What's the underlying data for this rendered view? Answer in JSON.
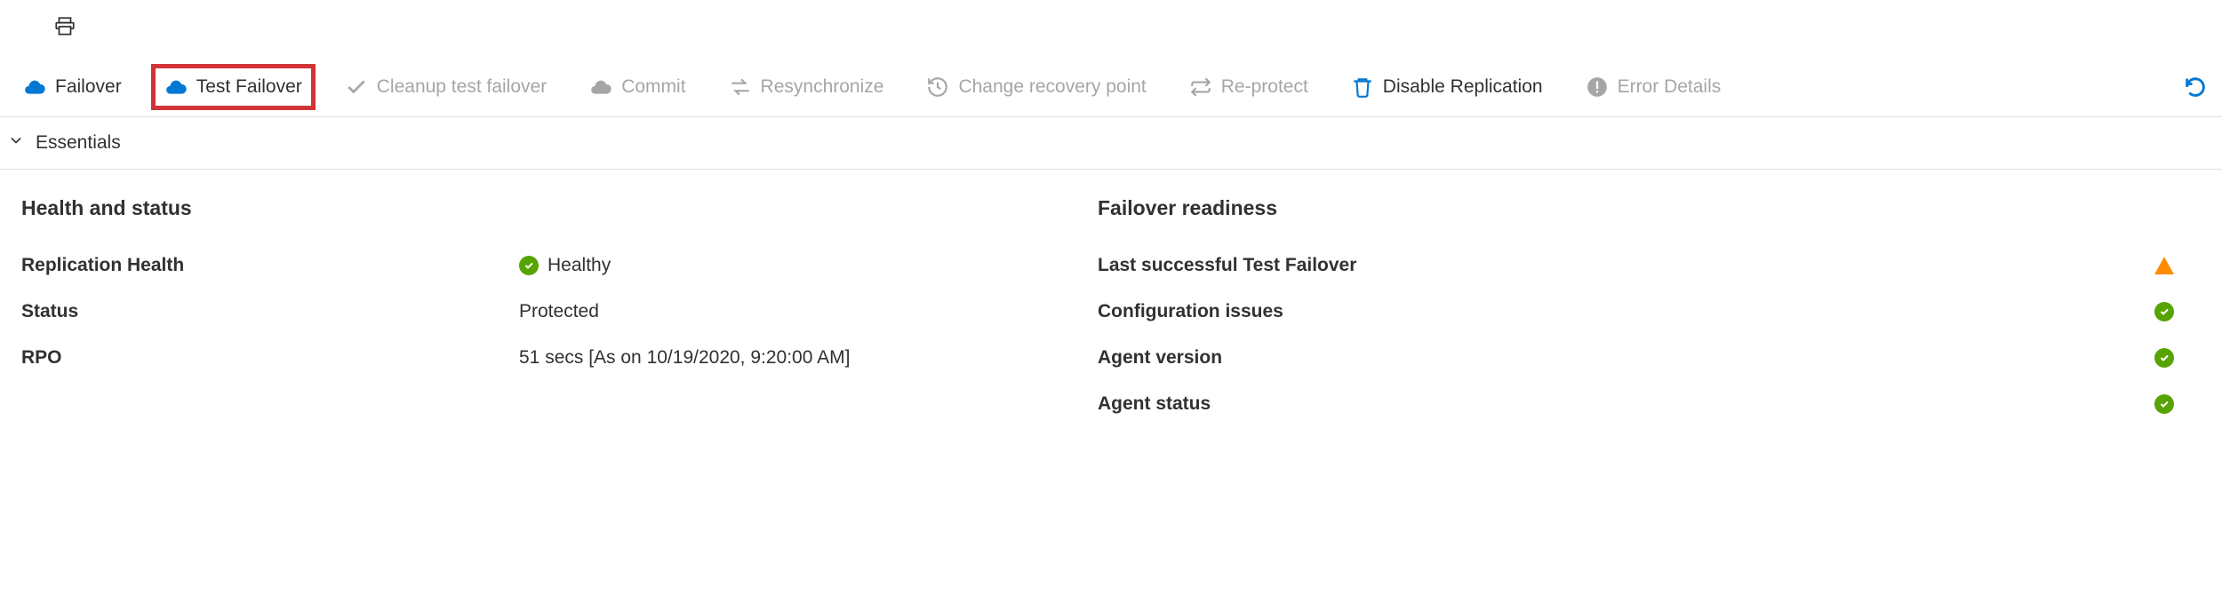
{
  "toolbar": {
    "failover": "Failover",
    "test_failover": "Test Failover",
    "cleanup": "Cleanup test failover",
    "commit": "Commit",
    "resync": "Resynchronize",
    "change_rp": "Change recovery point",
    "reprotect": "Re-protect",
    "disable_repl": "Disable Replication",
    "error_details": "Error Details"
  },
  "essentials": {
    "label": "Essentials"
  },
  "health": {
    "title": "Health and status",
    "replication_health_label": "Replication Health",
    "replication_health_value": "Healthy",
    "status_label": "Status",
    "status_value": "Protected",
    "rpo_label": "RPO",
    "rpo_value": "51 secs [As on 10/19/2020, 9:20:00 AM]"
  },
  "readiness": {
    "title": "Failover readiness",
    "last_test_failover": "Last successful Test Failover",
    "config_issues": "Configuration issues",
    "agent_version": "Agent version",
    "agent_status": "Agent status"
  }
}
